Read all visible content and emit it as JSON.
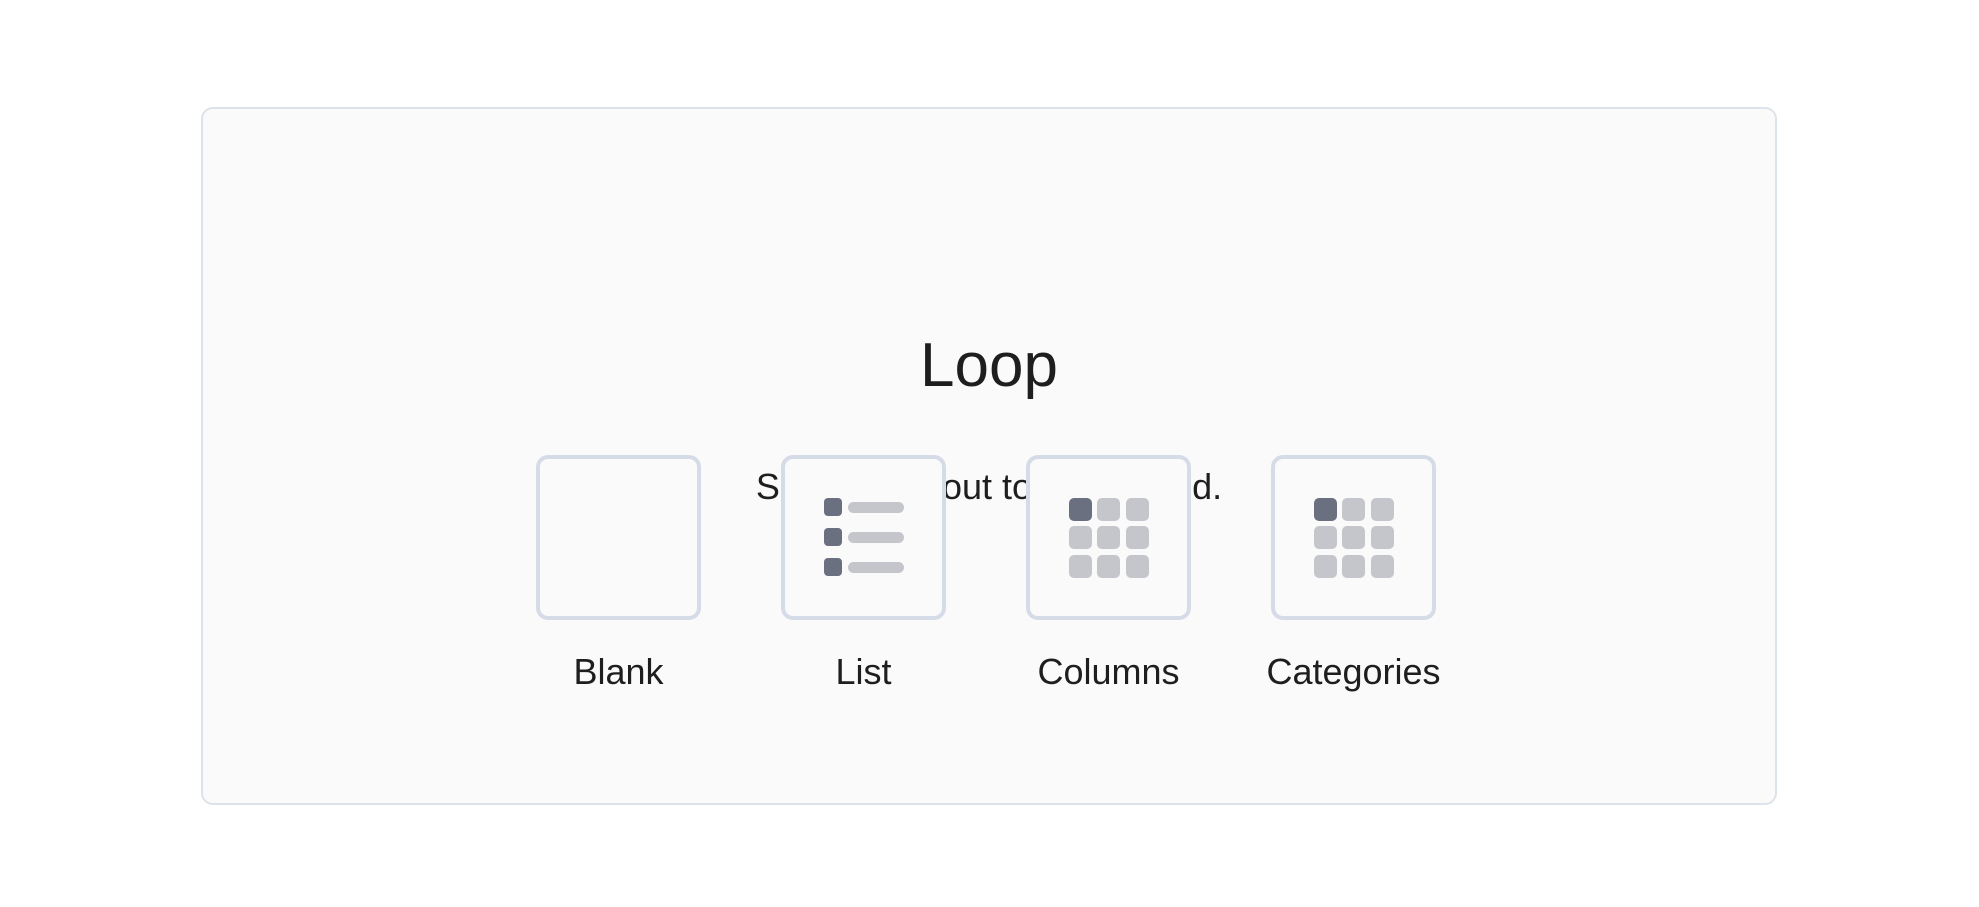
{
  "block": {
    "title": "Loop",
    "instructions": "Select a layout to get started."
  },
  "variations": [
    {
      "label": "Blank",
      "icon": "blank-layout-icon"
    },
    {
      "label": "List",
      "icon": "list-layout-icon"
    },
    {
      "label": "Columns",
      "icon": "columns-layout-icon"
    },
    {
      "label": "Categories",
      "icon": "categories-layout-icon"
    }
  ],
  "colors": {
    "icon_dark": "#6b7080",
    "icon_light": "#c4c6cc",
    "tile_border": "#d6dce7",
    "text": "#1e1e1e"
  }
}
